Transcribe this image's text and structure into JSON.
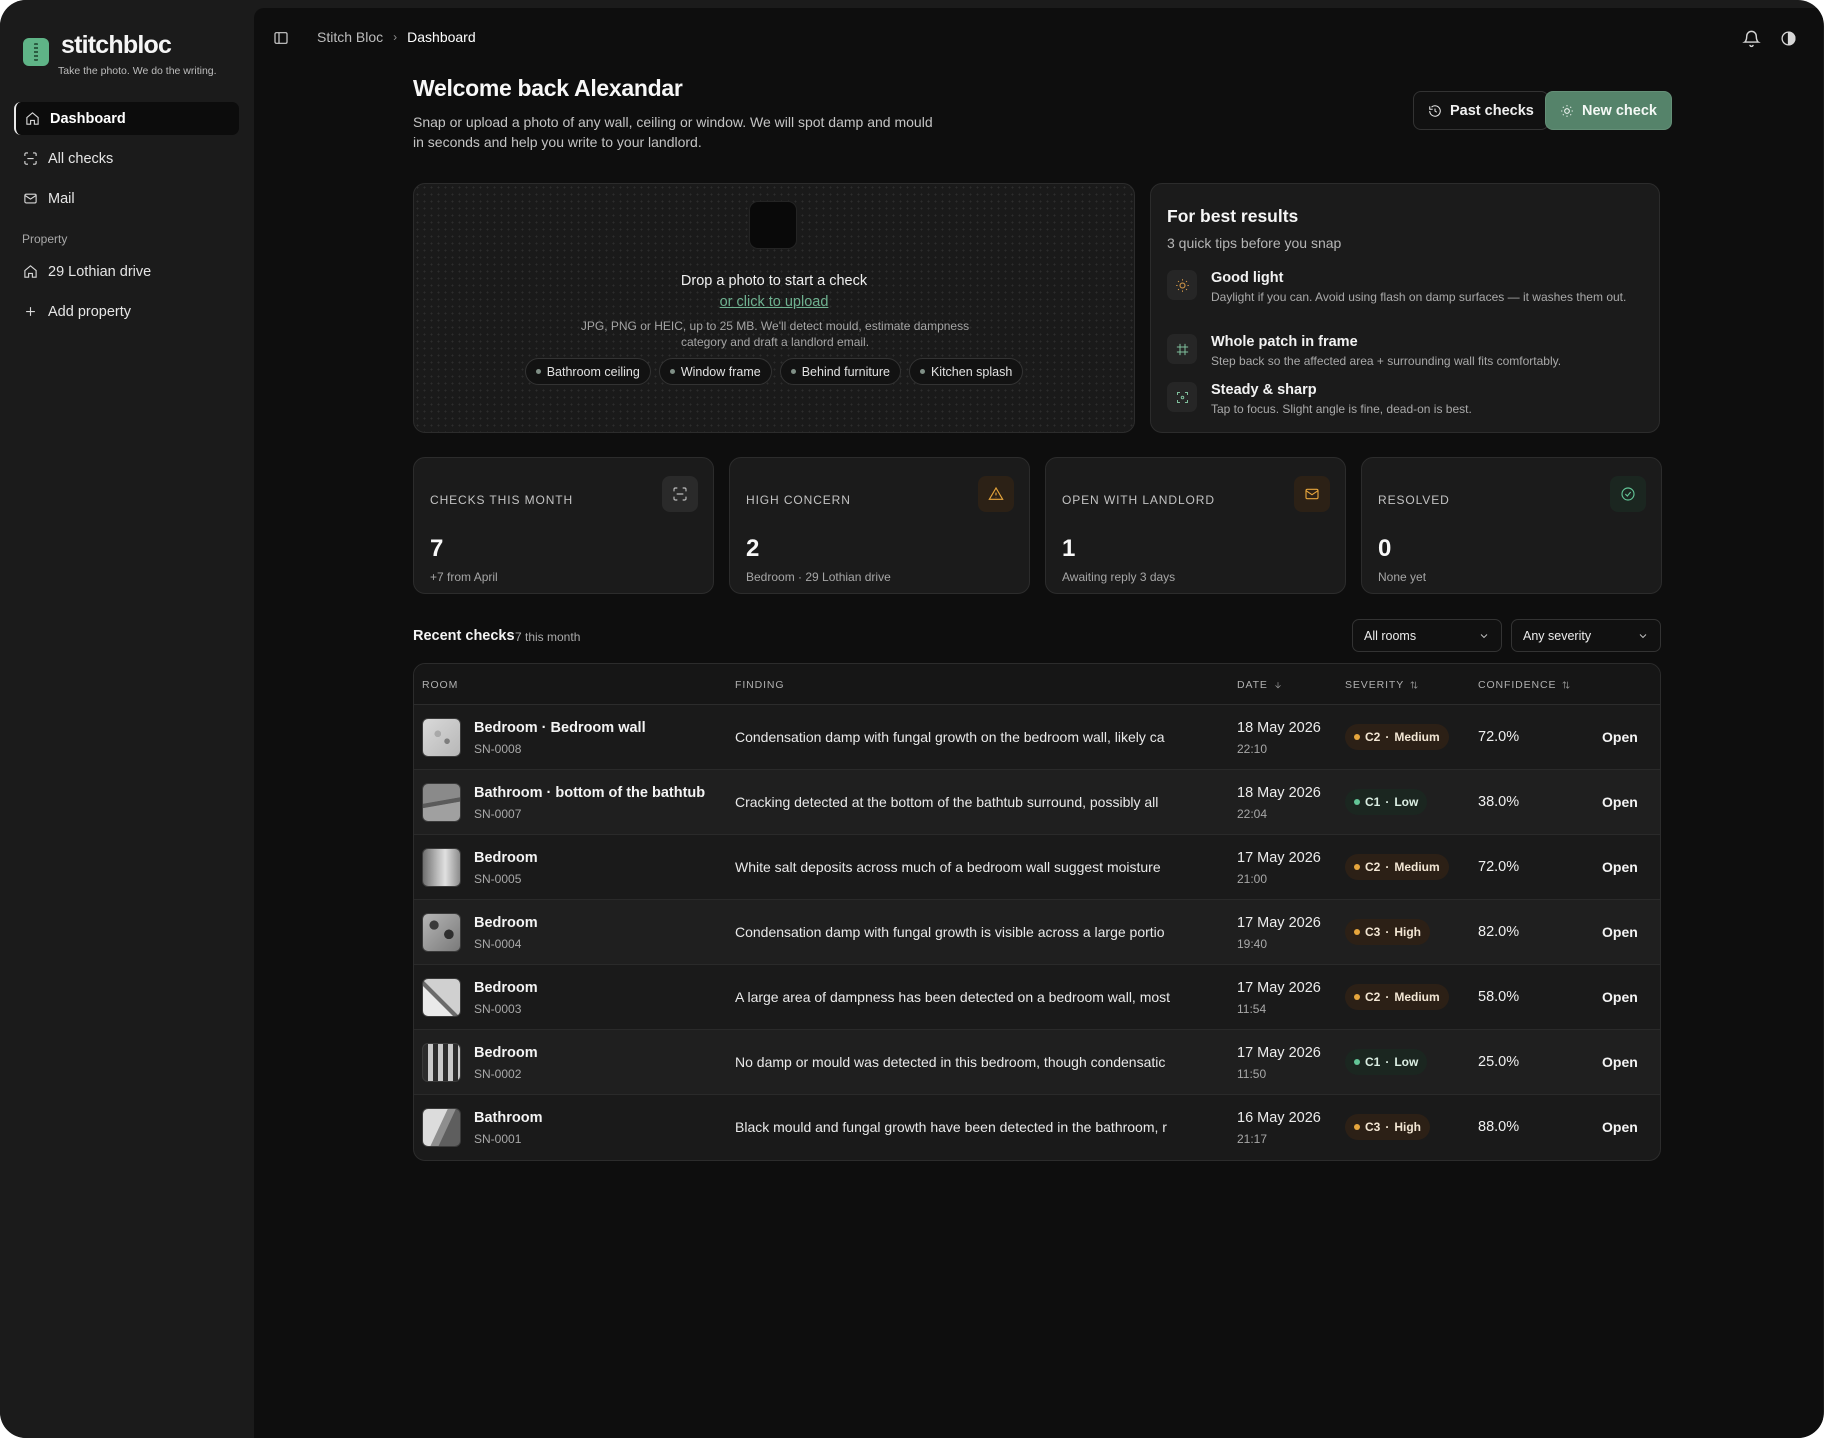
{
  "brand": {
    "name": "stitchbloc",
    "tagline": "Take the photo. We do the writing.",
    "accent": "#5fb487"
  },
  "sidebar": {
    "nav": [
      {
        "label": "Dashboard",
        "icon": "home-icon",
        "active": true
      },
      {
        "label": "All checks",
        "icon": "scan-icon"
      },
      {
        "label": "Mail",
        "icon": "mail-icon"
      }
    ],
    "section_label": "Property",
    "property": {
      "label": "29 Lothian drive",
      "icon": "home-icon"
    },
    "add_property": {
      "label": "Add property",
      "icon": "plus-icon"
    }
  },
  "header": {
    "breadcrumb": [
      "Stitch Bloc",
      "Dashboard"
    ],
    "title": "Welcome back Alexandar",
    "subtitle": "Snap or upload a photo of any wall, ceiling or window. We will spot damp and mould in seconds and help you write to your landlord.",
    "past_checks_label": "Past checks",
    "new_check_label": "New check"
  },
  "upload": {
    "title": "Drop a photo to start a check",
    "link": "or click to upload",
    "note": "JPG, PNG or HEIC, up to 25 MB. We'll detect mould, estimate dampness category and draft a landlord email.",
    "chips": [
      "Bathroom ceiling",
      "Window frame",
      "Behind furniture",
      "Kitchen splash"
    ]
  },
  "tips": {
    "title": "For best results",
    "subtitle": "3 quick tips before you snap",
    "items": [
      {
        "title": "Good light",
        "desc": "Daylight if you can. Avoid using flash on damp surfaces — it washes them out.",
        "icon": "sun-icon",
        "color": "#e0a04a"
      },
      {
        "title": "Whole patch in frame",
        "desc": "Step back so the affected area + surrounding wall fits comfortably.",
        "icon": "frame-icon",
        "color": "#7fbf9c"
      },
      {
        "title": "Steady & sharp",
        "desc": "Tap to focus. Slight angle is fine, dead-on is best.",
        "icon": "focus-icon",
        "color": "#7fbf9c"
      }
    ]
  },
  "stats": [
    {
      "label": "CHECKS THIS MONTH",
      "value": "7",
      "note": "+7 from April",
      "icon": "scan-icon",
      "color": "#bdbdbd"
    },
    {
      "label": "HIGH CONCERN",
      "value": "2",
      "note": "Bedroom · 29 Lothian drive",
      "icon": "warning-icon",
      "color": "#e6a53c"
    },
    {
      "label": "OPEN WITH LANDLORD",
      "value": "1",
      "note": "Awaiting reply 3 days",
      "icon": "mail-icon",
      "color": "#e6a53c"
    },
    {
      "label": "RESOLVED",
      "value": "0",
      "note": "None yet",
      "icon": "check-circle-icon",
      "color": "#63c597"
    }
  ],
  "recent": {
    "title": "Recent checks",
    "count": "7 this month",
    "filter_rooms": "All rooms",
    "filter_severity": "Any severity",
    "columns": {
      "room": "ROOM",
      "finding": "FINDING",
      "date": "DATE",
      "severity": "SEVERITY",
      "confidence": "CONFIDENCE"
    },
    "rows": [
      {
        "room": "Bedroom · Bedroom wall",
        "code": "SN-0008",
        "finding": "Condensation damp with fungal growth on the bedroom wall, likely ca",
        "date": "18 May 2026",
        "time": "22:10",
        "sev_code": "C2",
        "sev_level": "Medium",
        "confidence": "72.0%",
        "action": "Open"
      },
      {
        "room": "Bathroom · bottom of the bathtub",
        "code": "SN-0007",
        "finding": "Cracking detected at the bottom of the bathtub surround, possibly all",
        "date": "18 May 2026",
        "time": "22:04",
        "sev_code": "C1",
        "sev_level": "Low",
        "confidence": "38.0%",
        "action": "Open"
      },
      {
        "room": "Bedroom",
        "code": "SN-0005",
        "finding": "White salt deposits across much of a bedroom wall suggest moisture",
        "date": "17 May 2026",
        "time": "21:00",
        "sev_code": "C2",
        "sev_level": "Medium",
        "confidence": "72.0%",
        "action": "Open"
      },
      {
        "room": "Bedroom",
        "code": "SN-0004",
        "finding": "Condensation damp with fungal growth is visible across a large portio",
        "date": "17 May 2026",
        "time": "19:40",
        "sev_code": "C3",
        "sev_level": "High",
        "confidence": "82.0%",
        "action": "Open"
      },
      {
        "room": "Bedroom",
        "code": "SN-0003",
        "finding": "A large area of dampness has been detected on a bedroom wall, most",
        "date": "17 May 2026",
        "time": "11:54",
        "sev_code": "C2",
        "sev_level": "Medium",
        "confidence": "58.0%",
        "action": "Open"
      },
      {
        "room": "Bedroom",
        "code": "SN-0002",
        "finding": "No damp or mould was detected in this bedroom, though condensatic",
        "date": "17 May 2026",
        "time": "11:50",
        "sev_code": "C1",
        "sev_level": "Low",
        "confidence": "25.0%",
        "action": "Open"
      },
      {
        "room": "Bathroom",
        "code": "SN-0001",
        "finding": "Black mould and fungal growth have been detected in the bathroom, r",
        "date": "16 May 2026",
        "time": "21:17",
        "sev_code": "C3",
        "sev_level": "High",
        "confidence": "88.0%",
        "action": "Open"
      }
    ]
  }
}
